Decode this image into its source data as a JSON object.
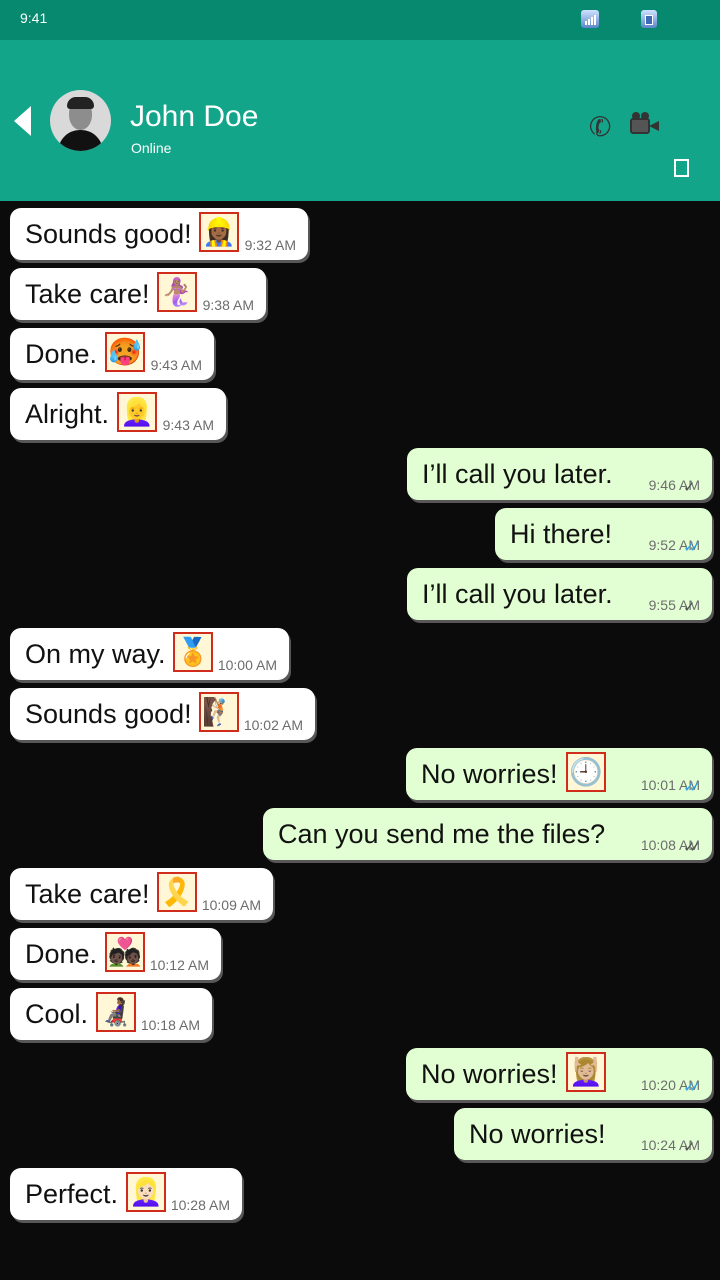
{
  "status_bar": {
    "time": "9:41",
    "icons": [
      "signal-icon",
      "battery-icon"
    ]
  },
  "header": {
    "contact_name": "John Doe",
    "contact_status": "Online",
    "back_icon": "back-arrow-icon",
    "call_icon": "phone-icon",
    "video_icon": "video-call-icon",
    "menu_icon": "menu-icon"
  },
  "colors": {
    "header": "#13a58a",
    "status_bar": "#07896f",
    "outgoing_bubble": "#e2ffd3",
    "incoming_bubble": "#ffffff",
    "read_check": "#33a7ea"
  },
  "messages": [
    {
      "direction": "in",
      "text": "Sounds good!",
      "emoji": "👷🏾‍♀️",
      "emoji_name": "woman-construction-worker-emoji",
      "time": "9:32 AM"
    },
    {
      "direction": "in",
      "text": "Take care!",
      "emoji": "🧜🏽‍♀️",
      "emoji_name": "mermaid-emoji",
      "time": "9:38 AM"
    },
    {
      "direction": "in",
      "text": "Done.",
      "emoji": "🥵",
      "emoji_name": "hot-face-emoji",
      "time": "9:43 AM"
    },
    {
      "direction": "in",
      "text": "Alright.",
      "emoji": "👱‍♀️",
      "emoji_name": "blond-woman-emoji",
      "time": "9:43 AM"
    },
    {
      "direction": "out",
      "text": "I’ll call you later.",
      "emoji": "",
      "emoji_name": "",
      "time": "9:46 AM",
      "status": "sent"
    },
    {
      "direction": "out",
      "text": "Hi there!",
      "emoji": "",
      "emoji_name": "",
      "time": "9:52 AM",
      "status": "read"
    },
    {
      "direction": "out",
      "text": "I’ll call you later.",
      "emoji": "",
      "emoji_name": "",
      "time": "9:55 AM",
      "status": "sent"
    },
    {
      "direction": "in",
      "text": "On my way.",
      "emoji": "🏅",
      "emoji_name": "sports-medal-emoji",
      "time": "10:00 AM"
    },
    {
      "direction": "in",
      "text": "Sounds good!",
      "emoji": "🧗🏼",
      "emoji_name": "person-climbing-emoji",
      "time": "10:02 AM"
    },
    {
      "direction": "out",
      "text": "No worries!",
      "emoji": "🕘",
      "emoji_name": "clock-emoji",
      "time": "10:01 AM",
      "status": "read"
    },
    {
      "direction": "out",
      "text": "Can you send me the files?",
      "emoji": "",
      "emoji_name": "",
      "time": "10:08 AM",
      "status": "delivered"
    },
    {
      "direction": "in",
      "text": "Take care!",
      "emoji": "🎗️",
      "emoji_name": "reminder-ribbon-emoji",
      "time": "10:09 AM"
    },
    {
      "direction": "in",
      "text": "Done.",
      "emoji": "💑🏿",
      "emoji_name": "couple-with-heart-emoji",
      "time": "10:12 AM"
    },
    {
      "direction": "in",
      "text": "Cool.",
      "emoji": "👩🏾‍🦼",
      "emoji_name": "person-in-wheelchair-emoji",
      "time": "10:18 AM"
    },
    {
      "direction": "out",
      "text": "No worries!",
      "emoji": "💆🏼‍♀️",
      "emoji_name": "woman-getting-massage-emoji",
      "time": "10:20 AM",
      "status": "read"
    },
    {
      "direction": "out",
      "text": "No worries!",
      "emoji": "",
      "emoji_name": "",
      "time": "10:24 AM",
      "status": "sent"
    },
    {
      "direction": "in",
      "text": "Perfect.",
      "emoji": "👱🏻‍♀️",
      "emoji_name": "blond-woman-emoji",
      "time": "10:28 AM"
    }
  ]
}
